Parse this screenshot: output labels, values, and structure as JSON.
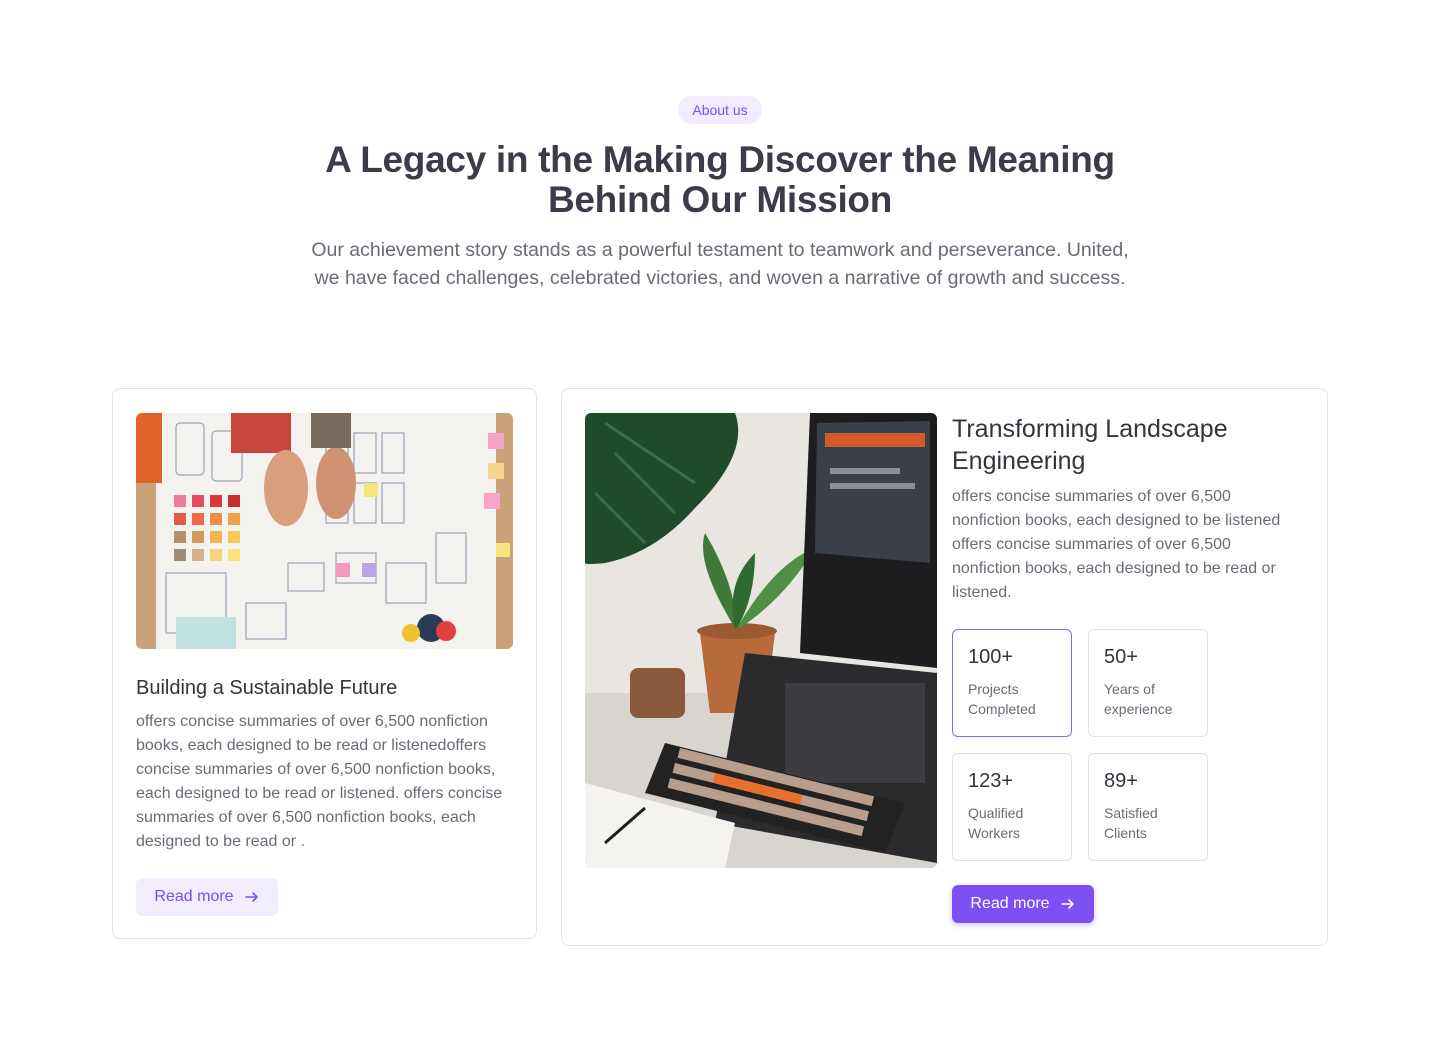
{
  "hero": {
    "badge": "About us",
    "title_line1": "A Legacy in the Making Discover the Meaning",
    "title_line2": "Behind Our Mission",
    "subtitle_line1": "Our achievement story stands as a powerful testament to teamwork and perseverance. United,",
    "subtitle_line2": "we have faced challenges, celebrated victories, and woven a narrative of growth and success."
  },
  "card_left": {
    "heading": "Building a Sustainable Future",
    "body": "offers concise summaries of over 6,500 nonfiction books, each designed to be read or listenedoffers concise summaries of over 6,500 nonfiction books, each designed to be read or listened. offers concise summaries of over 6,500 nonfiction books, each designed to be read or .",
    "button": "Read more",
    "button_icon": "arrow-right-icon"
  },
  "card_right": {
    "heading": "Transforming  Landscape Engineering",
    "body": "offers concise summaries of over 6,500 nonfiction books, each designed to be listened offers concise summaries of over 6,500 nonfiction books, each designed to be read or listened.",
    "stats": [
      {
        "value": "100+",
        "label": "Projects Completed"
      },
      {
        "value": "50+",
        "label": "Years of experience"
      },
      {
        "value": "123+",
        "label": "Qualified Workers"
      },
      {
        "value": "89+",
        "label": "Satisfied Clients"
      }
    ],
    "button": "Read more",
    "button_icon": "arrow-right-icon"
  },
  "colors": {
    "accent": "#7c4ff2",
    "accent_soft": "#f1ecfe",
    "text_dark": "#3b3b4a",
    "text_muted": "#6a6a78"
  }
}
